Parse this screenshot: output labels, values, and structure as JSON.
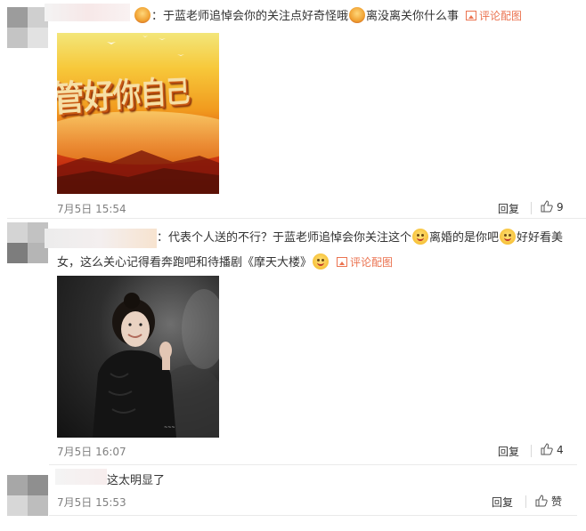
{
  "comments": [
    {
      "text_a": "：于蓝老师追悼会你的关注点好奇怪哦",
      "text_b": "离没离关你什么事",
      "pic_link_label": "评论配图",
      "image_banner_text": "管好你自己",
      "time": "7月5日 15:54",
      "reply_label": "回复",
      "like_count": "9"
    },
    {
      "text_a": "：代表个人送的不行？于蓝老师追悼会你关注这个",
      "text_b": "离婚的是你吧",
      "text_c": "好好看美",
      "line2_a": "女，这么关心记得看奔跑吧和待播剧《摩天大楼》",
      "pic_link_label": "评论配图",
      "time": "7月5日 16:07",
      "reply_label": "回复",
      "like_count": "4"
    },
    {
      "text": "这太明显了",
      "time": "7月5日 15:53",
      "reply_label": "回复",
      "like_label": "赞"
    }
  ],
  "colors": {
    "link": "#eb7350",
    "muted": "#808080",
    "text": "#333333"
  },
  "icons": [
    "thumbs-up-icon",
    "image-icon",
    "emoji-icon"
  ]
}
